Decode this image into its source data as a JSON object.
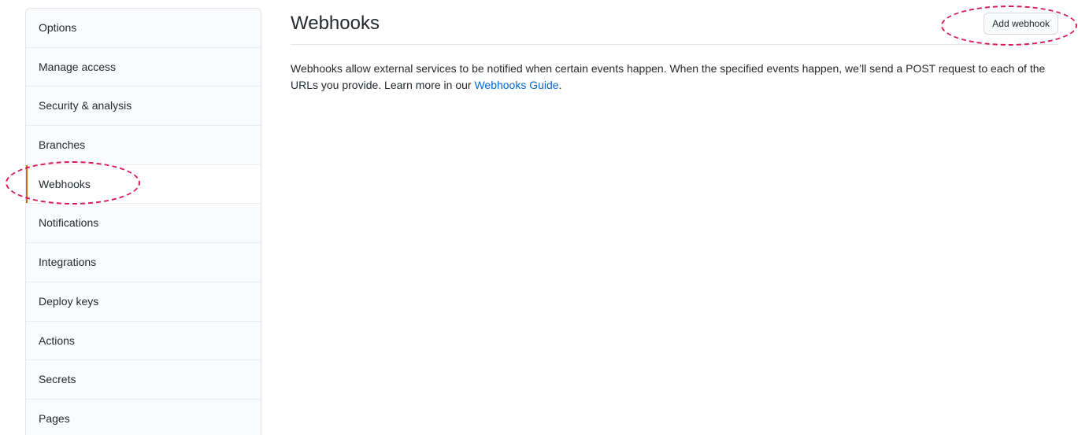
{
  "sidebar": {
    "items": [
      {
        "label": "Options"
      },
      {
        "label": "Manage access"
      },
      {
        "label": "Security & analysis"
      },
      {
        "label": "Branches"
      },
      {
        "label": "Webhooks",
        "selected": true
      },
      {
        "label": "Notifications"
      },
      {
        "label": "Integrations"
      },
      {
        "label": "Deploy keys"
      },
      {
        "label": "Actions"
      },
      {
        "label": "Secrets"
      },
      {
        "label": "Pages"
      }
    ]
  },
  "main": {
    "title": "Webhooks",
    "add_button_label": "Add webhook",
    "description_text": "Webhooks allow external services to be notified when certain events happen. When the specified events happen, we’ll send a POST request to each of the URLs you provide. Learn more in our ",
    "description_link": "Webhooks Guide",
    "description_end": "."
  },
  "colors": {
    "accent_selected": "#e36209",
    "link": "#0366d6",
    "annotation": "#d7195d"
  }
}
